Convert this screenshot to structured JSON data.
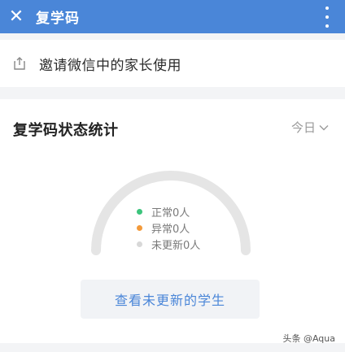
{
  "topbar": {
    "title": "复学码",
    "close_icon": "close-icon",
    "menu_icon": "more-vertical-icon",
    "background": "#4a86d8"
  },
  "invite": {
    "icon": "share-icon",
    "label": "邀请微信中的家长使用"
  },
  "stats": {
    "title": "复学码状态统计",
    "date_filter": "今日",
    "legend": [
      {
        "label": "正常0人",
        "color": "#3cc47c"
      },
      {
        "label": "异常0人",
        "color": "#f39a3a"
      },
      {
        "label": "未更新0人",
        "color": "#d8d8d8"
      }
    ],
    "gauge_color": "#e5e5e5",
    "action_button": "查看未更新的学生"
  },
  "watermark": "头条 @Aqua"
}
